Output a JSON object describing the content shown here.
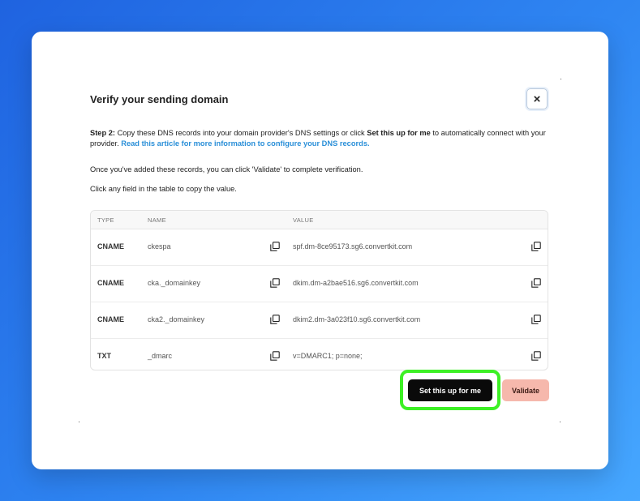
{
  "modal": {
    "title": "Verify your sending domain",
    "close_glyph": "×",
    "step_label": "Step 2:",
    "step_text_1": " Copy these DNS records into your domain provider's DNS settings or click ",
    "step_bold": "Set this up for me",
    "step_text_2": " to automatically connect with your provider. ",
    "step_link": "Read this article for more information to configure your DNS records.",
    "validate_hint": "Once you've added these records, you can click 'Validate' to complete verification.",
    "copy_hint": "Click any field in the table to copy the value."
  },
  "table": {
    "headers": {
      "type": "TYPE",
      "name": "NAME",
      "value": "VALUE"
    },
    "rows": [
      {
        "type": "CNAME",
        "name": "ckespa",
        "value": "spf.dm-8ce95173.sg6.convertkit.com"
      },
      {
        "type": "CNAME",
        "name": "cka._domainkey",
        "value": "dkim.dm-a2bae516.sg6.convertkit.com"
      },
      {
        "type": "CNAME",
        "name": "cka2._domainkey",
        "value": "dkim2.dm-3a023f10.sg6.convertkit.com"
      },
      {
        "type": "TXT",
        "name": "_dmarc",
        "value": "v=DMARC1; p=none;"
      }
    ]
  },
  "actions": {
    "setup_label": "Set this up for me",
    "validate_label": "Validate"
  },
  "colors": {
    "background_gradient_start": "#1f63e0",
    "background_gradient_end": "#46a7ff",
    "highlight_ring": "#3df025",
    "link": "#2a8fd8",
    "validate_bg": "#f6b8ac",
    "setup_bg": "#0a0a0a"
  },
  "icons": {
    "copy": "copy-icon",
    "close": "close-icon"
  }
}
